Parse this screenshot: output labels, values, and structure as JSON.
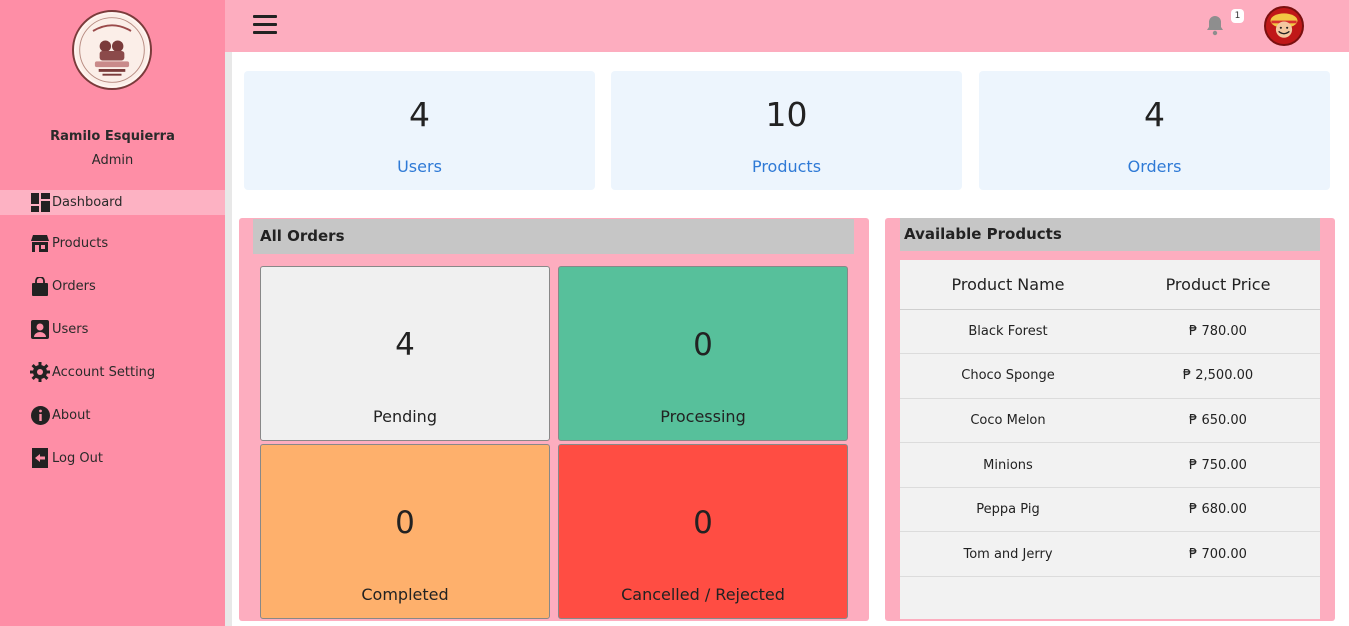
{
  "sidebar": {
    "user_name": "Ramilo Esquierra",
    "user_role": "Admin",
    "items": [
      {
        "label": "Dashboard",
        "icon": "dashboard-icon"
      },
      {
        "label": "Products",
        "icon": "store-icon"
      },
      {
        "label": "Orders",
        "icon": "shopping-bag-icon"
      },
      {
        "label": "Users",
        "icon": "user-icon"
      },
      {
        "label": "Account Setting",
        "icon": "gear-icon"
      },
      {
        "label": "About",
        "icon": "info-icon"
      },
      {
        "label": "Log Out",
        "icon": "logout-icon"
      }
    ]
  },
  "topbar": {
    "notification_count": "1"
  },
  "stats": [
    {
      "value": "4",
      "label": "Users"
    },
    {
      "value": "10",
      "label": "Products"
    },
    {
      "value": "4",
      "label": "Orders"
    }
  ],
  "orders": {
    "title": "All Orders",
    "boxes": [
      {
        "value": "4",
        "label": "Pending",
        "color": "#f0f0f0"
      },
      {
        "value": "0",
        "label": "Processing",
        "color": "#57c09b"
      },
      {
        "value": "0",
        "label": "Completed",
        "color": "#feb06c"
      },
      {
        "value": "0",
        "label": "Cancelled / Rejected",
        "color": "#ff4d43"
      }
    ]
  },
  "products": {
    "title": "Available Products",
    "columns": [
      "Product Name",
      "Product Price"
    ],
    "rows": [
      [
        "Black Forest",
        "₱ 780.00"
      ],
      [
        "Choco Sponge",
        "₱ 2,500.00"
      ],
      [
        "Coco Melon",
        "₱ 650.00"
      ],
      [
        "Minions",
        "₱ 750.00"
      ],
      [
        "Peppa Pig",
        "₱ 680.00"
      ],
      [
        "Tom and Jerry",
        "₱ 700.00"
      ]
    ]
  },
  "colors": {
    "sidebar": "#fe8ea6",
    "topbar": "#fdadbf",
    "accent_blue": "#2f7ad6"
  }
}
